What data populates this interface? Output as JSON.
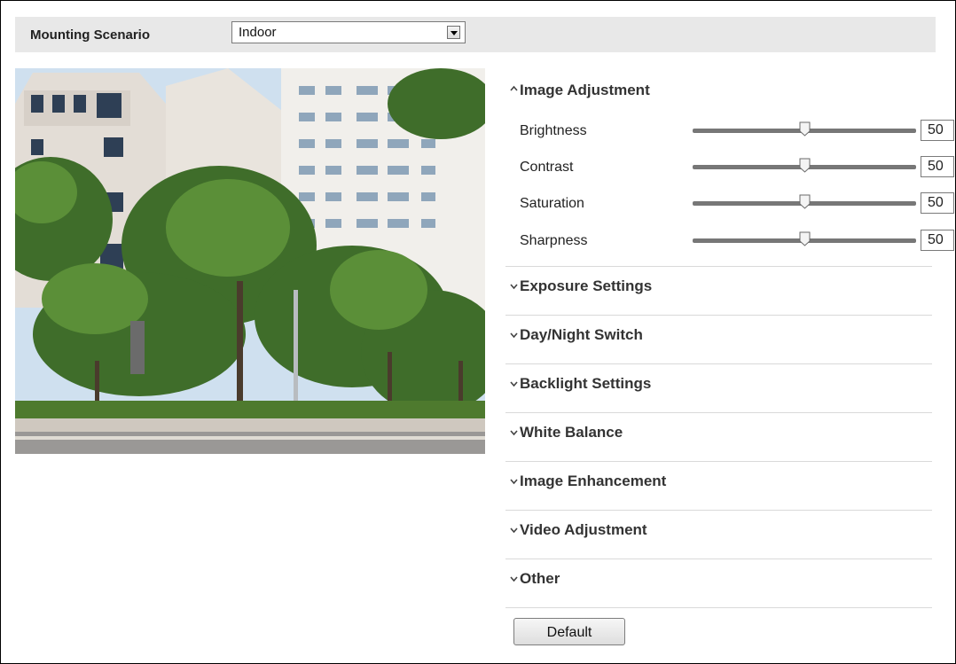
{
  "scenario": {
    "label": "Mounting Scenario",
    "value": "Indoor"
  },
  "image_adjustment": {
    "title": "Image Adjustment",
    "expanded": true,
    "sliders": [
      {
        "label": "Brightness",
        "value": "50",
        "level": 0.5
      },
      {
        "label": "Contrast",
        "value": "50",
        "level": 0.5
      },
      {
        "label": "Saturation",
        "value": "50",
        "level": 0.5
      },
      {
        "label": "Sharpness",
        "value": "50",
        "level": 0.5
      }
    ]
  },
  "sections": [
    {
      "title": "Exposure Settings"
    },
    {
      "title": "Day/Night Switch"
    },
    {
      "title": "Backlight Settings"
    },
    {
      "title": "White Balance"
    },
    {
      "title": "Image Enhancement"
    },
    {
      "title": "Video Adjustment"
    },
    {
      "title": "Other"
    }
  ],
  "default_button": "Default",
  "icons": {
    "expanded": "chevron-up-icon",
    "collapsed": "chevron-down-icon",
    "dropdown": "dropdown-arrow-icon"
  }
}
